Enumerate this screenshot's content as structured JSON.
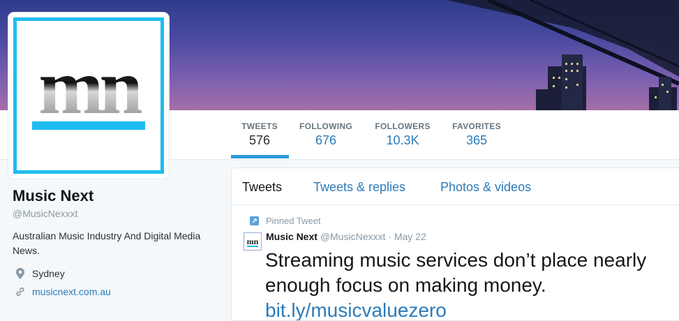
{
  "profile": {
    "name": "Music Next",
    "handle": "@MusicNexxxt",
    "bio": "Australian Music Industry And Digital Media News.",
    "location": "Sydney",
    "website": "musicnext.com.au",
    "avatar_text": "mn"
  },
  "stats": [
    {
      "label": "TWEETS",
      "value": "576"
    },
    {
      "label": "FOLLOWING",
      "value": "676"
    },
    {
      "label": "FOLLOWERS",
      "value": "10.3K"
    },
    {
      "label": "FAVORITES",
      "value": "365"
    }
  ],
  "tabs": [
    {
      "label": "Tweets"
    },
    {
      "label": "Tweets & replies"
    },
    {
      "label": "Photos & videos"
    }
  ],
  "tweet": {
    "pinned_label": "Pinned Tweet",
    "author": "Music Next",
    "handle": "@MusicNexxxt",
    "separator": "·",
    "date": "May 22",
    "text": "Streaming music services don’t place nearly enough focus on making money.",
    "link": "bit.ly/musicvaluezero"
  },
  "colors": {
    "accent": "#2b9bd6",
    "link": "#2b7bb9",
    "avatar_border": "#1ebcf0"
  }
}
